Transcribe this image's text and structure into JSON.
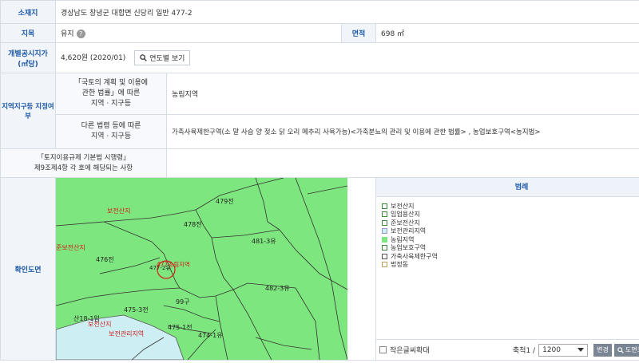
{
  "location": {
    "label": "소재지",
    "value": "경상남도 창녕군 대합면 신당리 일반 477-2"
  },
  "land_category": {
    "label": "지목",
    "value": "유지",
    "help": "?"
  },
  "area": {
    "label": "면적",
    "value": "698 ㎡"
  },
  "price": {
    "label_line1": "개별공시지가",
    "label_line2": "(㎡당)",
    "value": "4,620원 (2020/01)",
    "button": "연도별 보기"
  },
  "zoning": {
    "label": "지역지구등 지정여부",
    "row1_label_l1": "「국토의 계획 및 이용에",
    "row1_label_l2": "관한 법률」에 따른",
    "row1_label_l3": "지역 · 지구등",
    "row1_value": "농림지역",
    "row2_label_l1": "다른 법령 등에 따른",
    "row2_label_l2": "지역 · 지구등",
    "row2_value": "가축사육제한구역(소 말 사슴 양 젖소 닭 오리 메추리 사육가능)<가축분뇨의 관리 및 이용에 관한 법률> , 농업보호구역<농지법>"
  },
  "regulation": {
    "label_line1": "「토지이용규제 기본법 시행령」",
    "label_line2": "제9조제4항 각 호에 해당되는 사항",
    "value": ""
  },
  "map_section": {
    "label": "확인도면"
  },
  "map": {
    "parcels": [
      "479전",
      "478전",
      "481-3유",
      "476전",
      "477-2유",
      "482-3유",
      "475-3전",
      "99구",
      "475-1전",
      "474-1유",
      "산18-1임"
    ],
    "zones": [
      "보전산지",
      "보전관리지역",
      "농림지역",
      "준보전산지",
      "산18-1임 보전산지"
    ],
    "zone_labels": {
      "top": "보전산지",
      "left": "준보전산지",
      "center": "477농림지역",
      "bottom_left": "보전관리지역",
      "bottom": "보전산지"
    }
  },
  "legend": {
    "title": "범례",
    "items": [
      {
        "label": "보전산지",
        "color": "#ffffff",
        "border": "#3a8a3a"
      },
      {
        "label": "임업용산지",
        "color": "#ffffff",
        "border": "#3a8a3a"
      },
      {
        "label": "준보전산지",
        "color": "#ffffff",
        "border": "#3a8a3a"
      },
      {
        "label": "보전관리지역",
        "color": "#cdeef2",
        "border": "#99c"
      },
      {
        "label": "농림지역",
        "color": "#7ee67e",
        "border": "#7ee67e"
      },
      {
        "label": "농업보호구역",
        "color": "#ffffff",
        "border": "#3a8a3a"
      },
      {
        "label": "가축사육제한구역",
        "color": "#ffffff",
        "border": "#555"
      },
      {
        "label": "법정동",
        "color": "#ffffff",
        "border": "#c0a060"
      }
    ],
    "enlarge_label": "작은글씨확대",
    "scale_label": "축척1 /",
    "scale_value": "1200",
    "change_button": "변경",
    "print_button": "도면크게보기"
  },
  "colors": {
    "header_text": "#1e5aa8",
    "map_green": "#7ee67e",
    "map_cyan": "#cdeef2",
    "zone_red": "#d41e1e"
  }
}
